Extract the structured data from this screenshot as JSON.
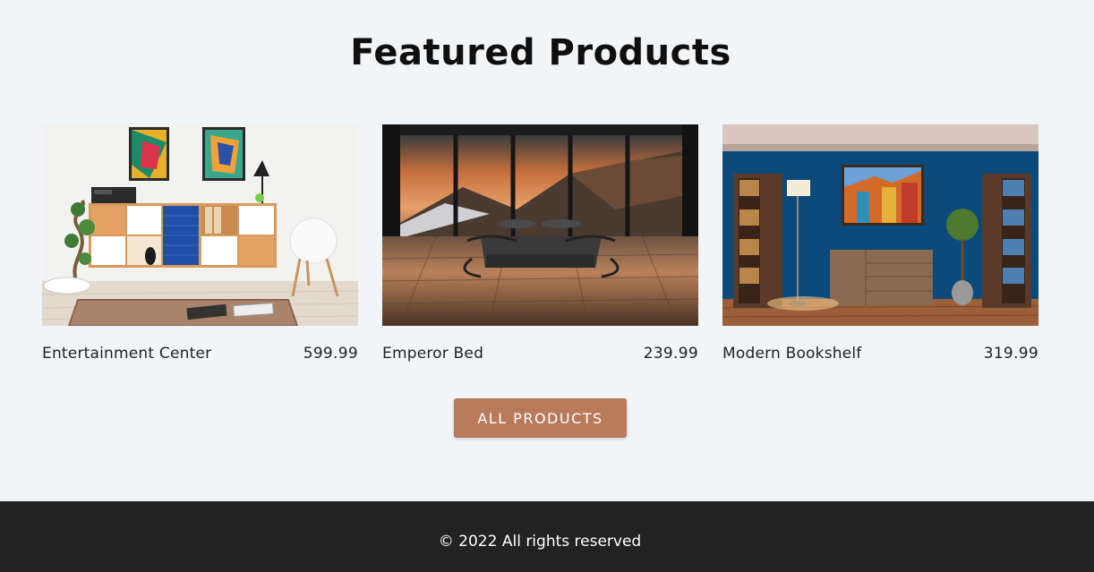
{
  "section": {
    "title": "Featured Products"
  },
  "products": [
    {
      "name": "Entertainment Center",
      "price": "599.99",
      "image_icon": "living-room-cabinet-photo"
    },
    {
      "name": "Emperor Bed",
      "price": "239.99",
      "image_icon": "bed-mountain-view-photo"
    },
    {
      "name": "Modern Bookshelf",
      "price": "319.99",
      "image_icon": "blue-room-bookshelf-photo"
    }
  ],
  "cta": {
    "label": "ALL PRODUCTS"
  },
  "footer": {
    "text": "© 2022 All rights reserved"
  },
  "colors": {
    "background": "#f1f5f8",
    "accent": "#b97a5c",
    "footer_bg": "#222222"
  }
}
